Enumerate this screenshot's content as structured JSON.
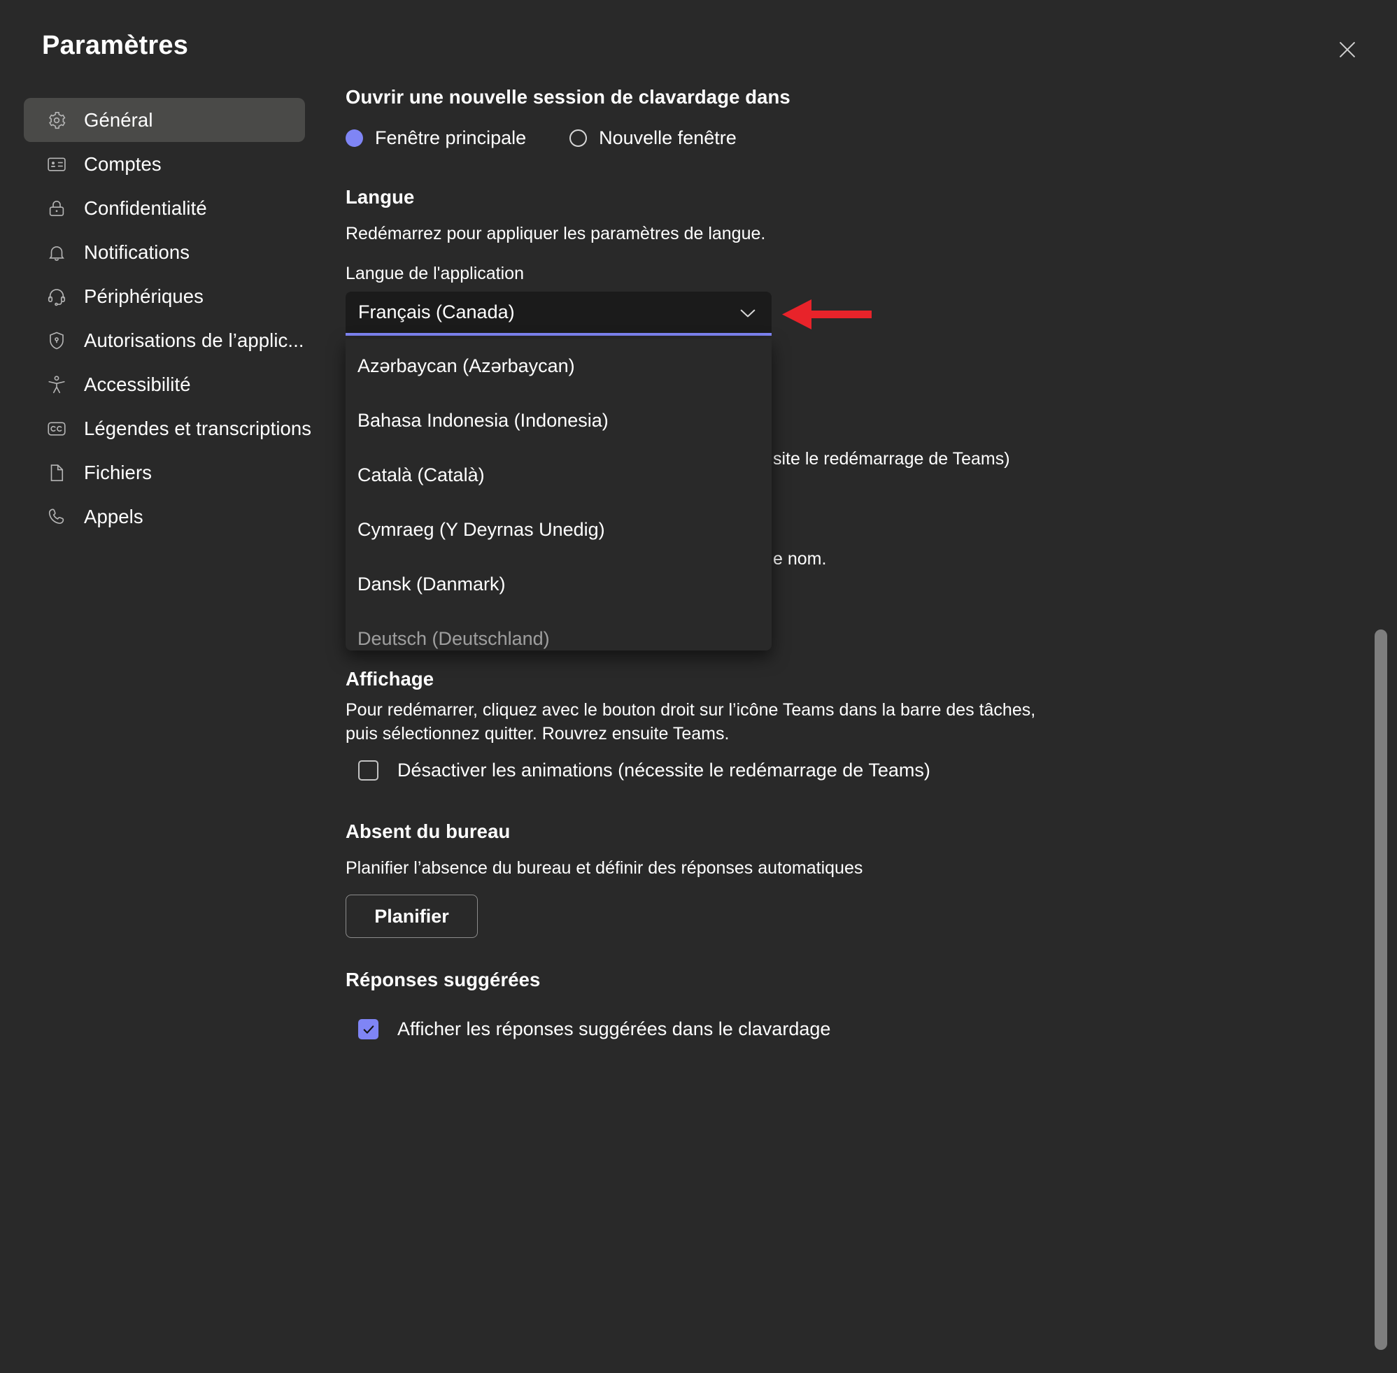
{
  "window": {
    "title": "Paramètres",
    "close_icon": "close-icon"
  },
  "sidebar": {
    "items": [
      {
        "id": "general",
        "label": "Général",
        "icon": "gear-icon",
        "active": true
      },
      {
        "id": "accounts",
        "label": "Comptes",
        "icon": "contact-card-icon",
        "active": false
      },
      {
        "id": "privacy",
        "label": "Confidentialité",
        "icon": "lock-icon",
        "active": false
      },
      {
        "id": "notifications",
        "label": "Notifications",
        "icon": "bell-icon",
        "active": false
      },
      {
        "id": "devices",
        "label": "Périphériques",
        "icon": "headset-icon",
        "active": false
      },
      {
        "id": "app-perms",
        "label": "Autorisations de l’applic...",
        "icon": "shield-lock-icon",
        "active": false
      },
      {
        "id": "accessibility",
        "label": "Accessibilité",
        "icon": "accessibility-icon",
        "active": false
      },
      {
        "id": "captions",
        "label": "Légendes et transcriptions",
        "icon": "closed-caption-icon",
        "active": false
      },
      {
        "id": "files",
        "label": "Fichiers",
        "icon": "file-icon",
        "active": false
      },
      {
        "id": "calls",
        "label": "Appels",
        "icon": "phone-icon",
        "active": false
      }
    ]
  },
  "main": {
    "open_chat": {
      "heading": "Ouvrir une nouvelle session de clavardage dans",
      "options": [
        {
          "label": "Fenêtre principale",
          "selected": true
        },
        {
          "label": "Nouvelle fenêtre",
          "selected": false
        }
      ]
    },
    "language": {
      "heading": "Langue",
      "description": "Redémarrez pour appliquer les paramètres de langue.",
      "field_label": "Langue de l'application",
      "selected_value": "Français (Canada)",
      "chevron_icon": "chevron-down-icon",
      "dropdown_open": true,
      "dropdown_options": [
        "Azərbaycan (Azərbaycan)",
        "Bahasa Indonesia (Indonesia)",
        "Català (Català)",
        "Cymraeg (Y Deyrnas Unedig)",
        "Dansk (Danmark)",
        "Deutsch (Deutschland)"
      ],
      "obscured_text_right_1": "site le redémarrage de Teams)",
      "obscured_text_right_2": "e nom."
    },
    "display": {
      "heading": "Affichage",
      "description": "Pour redémarrer, cliquez avec le bouton droit sur l’icône Teams dans la barre des tâches, puis sélectionnez quitter. Rouvrez ensuite Teams.",
      "checkbox_label": "Désactiver les animations (nécessite le redémarrage de Teams)",
      "checkbox_checked": false
    },
    "out_of_office": {
      "heading": "Absent du bureau",
      "description": "Planifier l’absence du bureau et définir des réponses automatiques",
      "button_label": "Planifier"
    },
    "suggested_replies": {
      "heading": "Réponses suggérées",
      "checkbox_label": "Afficher les réponses suggérées dans le clavardage",
      "checkbox_checked": true
    }
  },
  "colors": {
    "accent": "#7f85f5",
    "annotation": "#e8232a",
    "surface": "#292929",
    "surface_dark": "#1b1b1b",
    "active_nav": "#4a4a48"
  },
  "annotation": {
    "arrow_icon": "left-arrow-annotation",
    "points_at": "chevron-down-icon"
  },
  "scrollbar": {
    "thumb": "vertical-scroll-thumb"
  }
}
